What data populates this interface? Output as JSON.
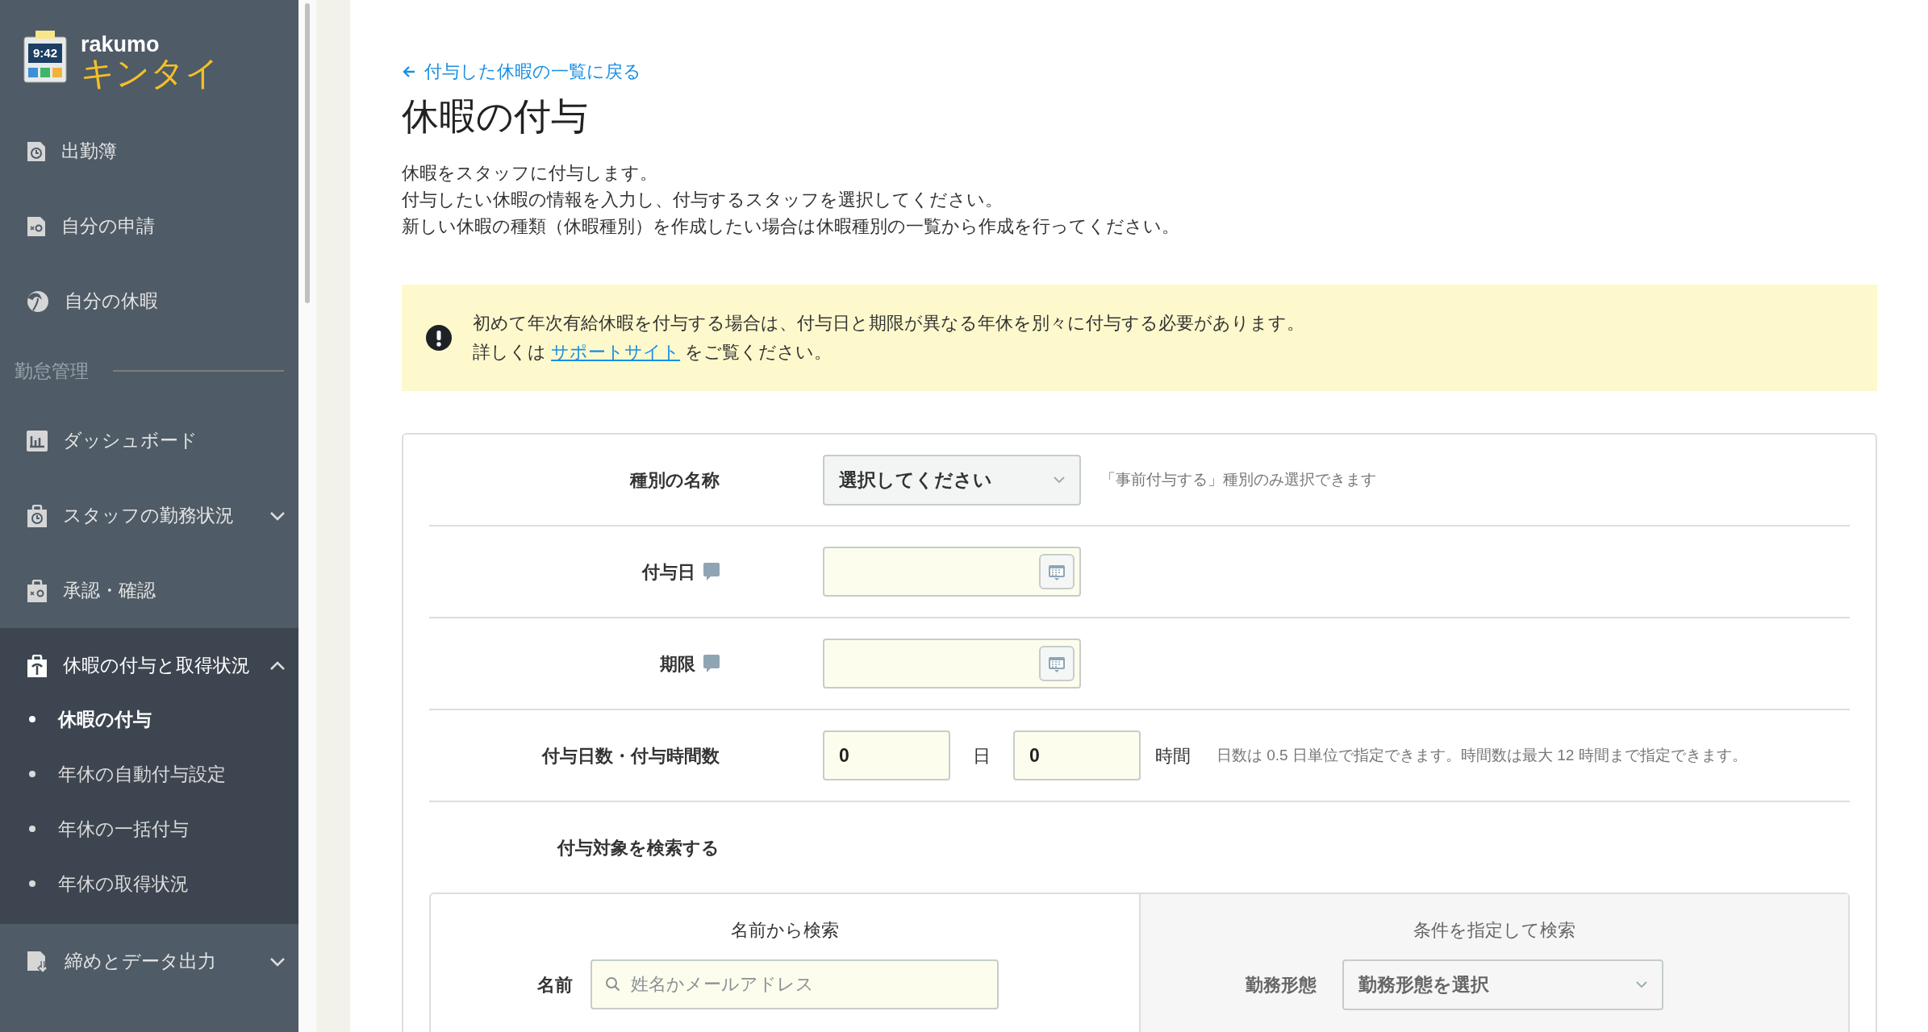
{
  "sidebar": {
    "logo": {
      "clock": "9:42",
      "brand": "rakumo",
      "product": "キンタイ"
    },
    "items": [
      {
        "kind": "link",
        "label": "出勤簿"
      },
      {
        "kind": "link",
        "label": "自分の申請"
      },
      {
        "kind": "link",
        "label": "自分の休暇"
      },
      {
        "kind": "section",
        "label": "勤怠管理"
      },
      {
        "kind": "link",
        "label": "ダッシュボード"
      },
      {
        "kind": "group",
        "label": "スタッフの勤務状況",
        "expanded": false
      },
      {
        "kind": "link",
        "label": "承認・確認"
      },
      {
        "kind": "group",
        "label": "休暇の付与と取得状況",
        "expanded": true,
        "children": [
          {
            "label": "休暇の付与",
            "selected": true
          },
          {
            "label": "年休の自動付与設定",
            "selected": false
          },
          {
            "label": "年休の一括付与",
            "selected": false
          },
          {
            "label": "年休の取得状況",
            "selected": false
          }
        ]
      },
      {
        "kind": "group",
        "label": "締めとデータ出力",
        "expanded": false
      }
    ]
  },
  "back_link": "付与した休暇の一覧に戻る",
  "title": "休暇の付与",
  "description": [
    "休暇をスタッフに付与します。",
    "付与したい休暇の情報を入力し、付与するスタッフを選択してください。",
    "新しい休暇の種類（休暇種別）を作成したい場合は休暇種別の一覧から作成を行ってください。"
  ],
  "alert": {
    "message": "初めて年次有給休暇を付与する場合は、付与日と期限が異なる年休を別々に付与する必要があります。",
    "detail_before": "詳しくは ",
    "link": "サポートサイト",
    "detail_after": " をご覧ください。"
  },
  "form": {
    "rows": [
      {
        "kind": "select",
        "label": "種別の名称",
        "help": false,
        "value": "選択してください",
        "hint": "「事前付与する」種別のみ選択できます"
      },
      {
        "kind": "date",
        "label": "付与日",
        "help": true
      },
      {
        "kind": "date",
        "label": "期限",
        "help": true
      },
      {
        "kind": "amount",
        "label": "付与日数・付与時間数",
        "help": false,
        "days": "0",
        "days_unit": "日",
        "hours": "0",
        "hours_unit": "時間",
        "hint": "日数は 0.5 日単位で指定できます。時間数は最大 12 時間まで指定できます。"
      }
    ],
    "search": {
      "label": "付与対象を検索する",
      "tabs": [
        {
          "label": "名前から検索",
          "selected": true
        },
        {
          "label": "条件を指定して検索",
          "selected": false
        }
      ],
      "name_field": {
        "label": "名前",
        "placeholder": "姓名かメールアドレス"
      },
      "condition_field": {
        "label": "勤務形態",
        "value": "勤務形態を選択"
      }
    }
  }
}
